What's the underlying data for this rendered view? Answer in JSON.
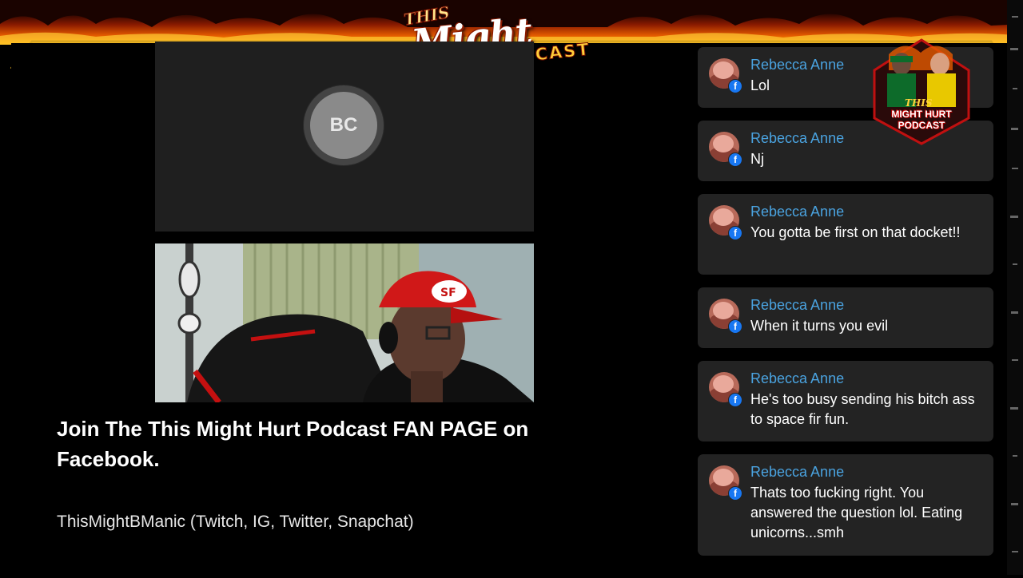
{
  "banner": {
    "logo_this": "THIS",
    "logo_might_hurt": "Might Hurt",
    "logo_podcast": "PODCAST"
  },
  "video": {
    "participant_initials": "BC"
  },
  "promo": {
    "headline": "Join The This Might Hurt Podcast FAN PAGE on Facebook.",
    "socials": "ThisMightBManic (Twitch, IG, Twitter, Snapchat)"
  },
  "badge": {
    "this": "THIS",
    "caption": "MIGHT HURT PODCAST"
  },
  "comments": [
    {
      "name": "Rebecca Anne",
      "text": "Lol",
      "platform_icon": "facebook-icon"
    },
    {
      "name": "Rebecca Anne",
      "text": "Nj",
      "platform_icon": "facebook-icon"
    },
    {
      "name": "Rebecca Anne",
      "text": "You gotta be first on that docket!!",
      "platform_icon": "facebook-icon"
    },
    {
      "name": "Rebecca Anne",
      "text": "When it turns you evil",
      "platform_icon": "facebook-icon"
    },
    {
      "name": "Rebecca Anne",
      "text": "He's too busy sending his bitch ass to space fir fun.",
      "platform_icon": "facebook-icon"
    },
    {
      "name": "Rebecca Anne",
      "text": "Thats too fucking right. You answered the question lol. Eating unicorns...smh",
      "platform_icon": "facebook-icon"
    }
  ],
  "colors": {
    "commenter_name": "#4aa3e0",
    "facebook_blue": "#1877f2",
    "comment_bg": "#232323"
  }
}
